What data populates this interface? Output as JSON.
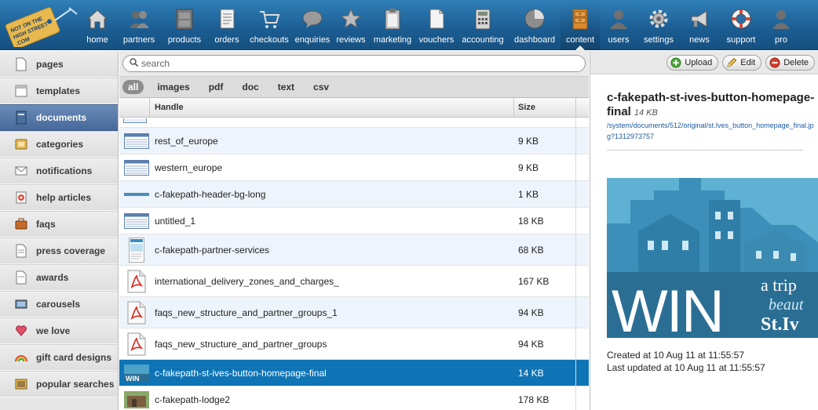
{
  "brand": {
    "logo_text_1": "NOT ON THE",
    "logo_text_2": "HIGH STREET",
    "logo_text_3": ".COM"
  },
  "topnav": {
    "items": [
      {
        "label": "home",
        "icon": "house-icon"
      },
      {
        "label": "partners",
        "icon": "people-icon"
      },
      {
        "label": "products",
        "icon": "cabinet-icon"
      },
      {
        "label": "orders",
        "icon": "document-list-icon"
      },
      {
        "label": "checkouts",
        "icon": "shopping-cart-icon"
      },
      {
        "label": "enquiries",
        "icon": "speech-bubble-icon"
      },
      {
        "label": "reviews",
        "icon": "star-icon"
      },
      {
        "label": "marketing",
        "icon": "clipboard-icon"
      },
      {
        "label": "vouchers",
        "icon": "page-icon"
      },
      {
        "label": "accounting",
        "icon": "calculator-icon"
      },
      {
        "label": "dashboard",
        "icon": "pie-chart-icon"
      },
      {
        "label": "content",
        "icon": "drawers-icon"
      },
      {
        "label": "users",
        "icon": "user-icon"
      },
      {
        "label": "settings",
        "icon": "gear-icon"
      },
      {
        "label": "news",
        "icon": "megaphone-icon"
      },
      {
        "label": "support",
        "icon": "lifebuoy-icon"
      },
      {
        "label": "pro",
        "icon": "user-icon"
      }
    ],
    "active": "content"
  },
  "sidebar": {
    "items": [
      {
        "label": "pages",
        "icon": "page-icon"
      },
      {
        "label": "templates",
        "icon": "template-icon"
      },
      {
        "label": "documents",
        "icon": "document-icon"
      },
      {
        "label": "categories",
        "icon": "folder-icon"
      },
      {
        "label": "notifications",
        "icon": "envelope-icon"
      },
      {
        "label": "help articles",
        "icon": "help-icon"
      },
      {
        "label": "faqs",
        "icon": "briefcase-icon"
      },
      {
        "label": "press coverage",
        "icon": "newspaper-icon"
      },
      {
        "label": "awards",
        "icon": "page-icon"
      },
      {
        "label": "carousels",
        "icon": "carousel-icon"
      },
      {
        "label": "we love",
        "icon": "heart-icon"
      },
      {
        "label": "gift card designs",
        "icon": "rainbow-icon"
      },
      {
        "label": "popular searches",
        "icon": "photo-icon"
      }
    ],
    "active": "documents"
  },
  "search": {
    "placeholder": "search",
    "value": ""
  },
  "filters": [
    "all",
    "images",
    "pdf",
    "doc",
    "text",
    "csv"
  ],
  "active_filter": "all",
  "table": {
    "headers": {
      "handle": "Handle",
      "size": "Size"
    },
    "rows": [
      {
        "name": "rest_of_europe",
        "size": "9 KB",
        "thumb": "spreadsheet-thumb"
      },
      {
        "name": "western_europe",
        "size": "9 KB",
        "thumb": "spreadsheet-thumb"
      },
      {
        "name": "c-fakepath-header-bg-long",
        "size": "1 KB",
        "thumb": "bar-thumb"
      },
      {
        "name": "untitled_1",
        "size": "18 KB",
        "thumb": "spreadsheet-thumb"
      },
      {
        "name": "c-fakepath-partner-services",
        "size": "68 KB",
        "thumb": "webpage-thumb"
      },
      {
        "name": "international_delivery_zones_and_charges_",
        "size": "167 KB",
        "thumb": "pdf-icon"
      },
      {
        "name": "faqs_new_structure_and_partner_groups_1",
        "size": "94 KB",
        "thumb": "pdf-icon"
      },
      {
        "name": "faqs_new_structure_and_partner_groups",
        "size": "94 KB",
        "thumb": "pdf-icon"
      },
      {
        "name": "c-fakepath-st-ives-button-homepage-final",
        "size": "14 KB",
        "thumb": "image-thumb"
      },
      {
        "name": "c-fakepath-lodge2",
        "size": "178 KB",
        "thumb": "photo-thumb"
      }
    ],
    "selected_index": 8
  },
  "detail": {
    "toolbar": {
      "upload": "Upload",
      "edit": "Edit",
      "delete": "Delete"
    },
    "title": "c-fakepath-st-ives-button-homepage-final",
    "size": "14 KB",
    "path": "/system/documents/512/original/st.Ives_button_homepage_final.jpg?1312973757",
    "preview": {
      "headline": "WIN",
      "line1": "a trip",
      "line2": "beaut",
      "line3": "St.Iv"
    },
    "created": "Created at 10 Aug 11 at 11:55:57",
    "updated": "Last updated at 10 Aug 11 at 11:55:57"
  },
  "colors": {
    "nav_blue": "#1f6aa5",
    "selected_row": "#0e74b6",
    "sidebar_active": "#5378a8",
    "preview_teal": "#4ba3c7"
  }
}
